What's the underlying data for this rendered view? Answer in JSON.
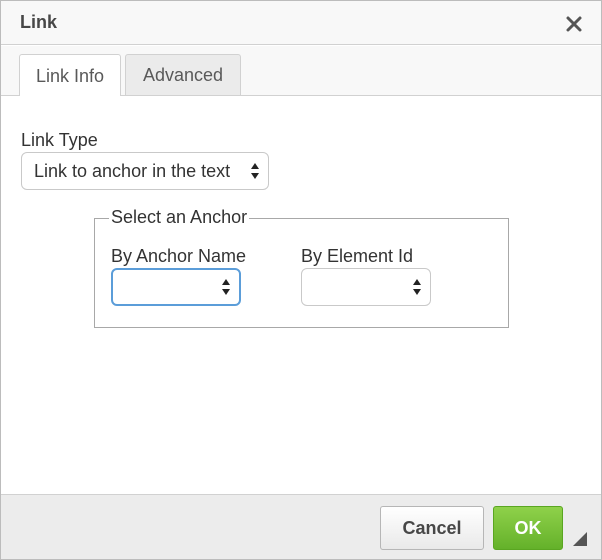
{
  "dialog": {
    "title": "Link"
  },
  "tabs": [
    {
      "label": "Link Info",
      "active": true
    },
    {
      "label": "Advanced",
      "active": false
    }
  ],
  "link_type": {
    "label": "Link Type",
    "selected": "Link to anchor in the text"
  },
  "anchor": {
    "legend": "Select an Anchor",
    "by_name": {
      "label": "By Anchor Name",
      "selected": ""
    },
    "by_id": {
      "label": "By Element Id",
      "selected": ""
    }
  },
  "footer": {
    "cancel_label": "Cancel",
    "ok_label": "OK"
  },
  "colors": {
    "ok_green": "#6cbb2f",
    "focus_blue": "#5b9dd9",
    "panel_gray": "#ececec"
  },
  "icons": {
    "close": "close-icon",
    "select_arrows": "select-arrows-icon",
    "resize": "resize-grip-icon"
  }
}
